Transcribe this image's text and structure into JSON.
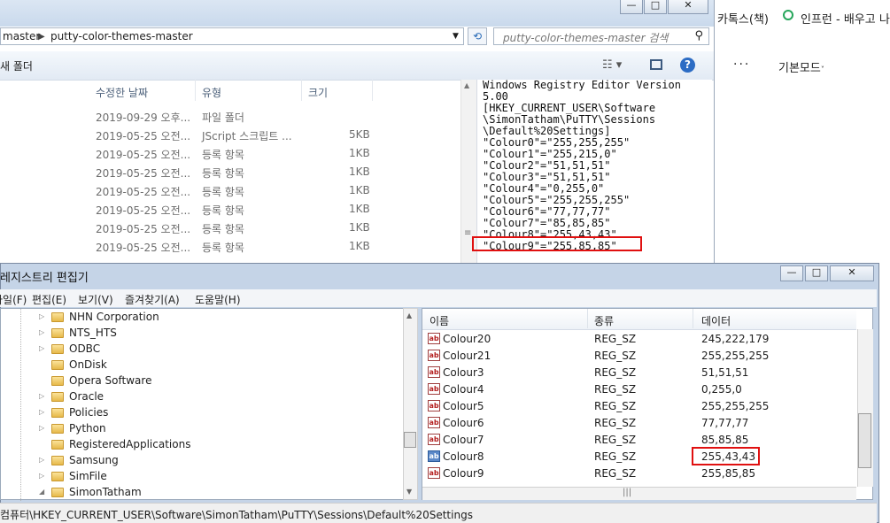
{
  "browser": {
    "bookmark_kakao": "카톡스(책)",
    "bookmark_inflearn": "인프런 - 배우고 나",
    "basic_mode": "기본모드",
    "more": "···"
  },
  "explorer": {
    "breadcrumb_prev": "master",
    "breadcrumb_current": "putty-color-themes-master",
    "search_placeholder": "putty-color-themes-master 검색",
    "new_folder": "새 폴더",
    "columns": {
      "modified": "수정한 날짜",
      "type": "유형",
      "size": "크기"
    },
    "files": [
      {
        "date": "2019-09-29 오후...",
        "type": "파일 폴더",
        "size": ""
      },
      {
        "date": "2019-05-25 오전...",
        "type": "JScript 스크립트 ...",
        "size": "5KB"
      },
      {
        "date": "2019-05-25 오전...",
        "type": "등록 항목",
        "size": "1KB"
      },
      {
        "date": "2019-05-25 오전...",
        "type": "등록 항목",
        "size": "1KB"
      },
      {
        "date": "2019-05-25 오전...",
        "type": "등록 항목",
        "size": "1KB"
      },
      {
        "date": "2019-05-25 오전...",
        "type": "등록 항목",
        "size": "1KB"
      },
      {
        "date": "2019-05-25 오전...",
        "type": "등록 항목",
        "size": "1KB"
      },
      {
        "date": "2019-05-25 오전...",
        "type": "등록 항목",
        "size": "1KB"
      }
    ],
    "preview_lines": [
      "Windows Registry Editor Version",
      "5.00",
      "",
      "[HKEY_CURRENT_USER\\Software",
      "\\SimonTatham\\PuTTY\\Sessions",
      "\\Default%20Settings]",
      "\"Colour0\"=\"255,255,255\"",
      "\"Colour1\"=\"255,215,0\"",
      "\"Colour2\"=\"51,51,51\"",
      "\"Colour3\"=\"51,51,51\"",
      "\"Colour4\"=\"0,255,0\"",
      "\"Colour5\"=\"255,255,255\"",
      "\"Colour6\"=\"77,77,77\"",
      "\"Colour7\"=\"85,85,85\"",
      "\"Colour8\"=\"255,43,43\"",
      "\"Colour9\"=\"255,85,85\""
    ]
  },
  "regedit": {
    "title": "레지스트리 편집기",
    "menu": [
      "파일(F)",
      "편집(E)",
      "보기(V)",
      "즐겨찾기(A)",
      "도움말(H)"
    ],
    "tree": [
      {
        "label": "NHN Corporation",
        "expandable": true
      },
      {
        "label": "NTS_HTS",
        "expandable": true
      },
      {
        "label": "ODBC",
        "expandable": true
      },
      {
        "label": "OnDisk",
        "expandable": false
      },
      {
        "label": "Opera Software",
        "expandable": false
      },
      {
        "label": "Oracle",
        "expandable": true
      },
      {
        "label": "Policies",
        "expandable": true
      },
      {
        "label": "Python",
        "expandable": true
      },
      {
        "label": "RegisteredApplications",
        "expandable": false
      },
      {
        "label": "Samsung",
        "expandable": true
      },
      {
        "label": "SimFile",
        "expandable": true
      },
      {
        "label": "SimonTatham",
        "expandable": true
      }
    ],
    "list_columns": {
      "name": "이름",
      "type": "종류",
      "data": "데이터"
    },
    "values": [
      {
        "name": "Colour20",
        "type": "REG_SZ",
        "data": "245,222,179"
      },
      {
        "name": "Colour21",
        "type": "REG_SZ",
        "data": "255,255,255"
      },
      {
        "name": "Colour3",
        "type": "REG_SZ",
        "data": "51,51,51"
      },
      {
        "name": "Colour4",
        "type": "REG_SZ",
        "data": "0,255,0"
      },
      {
        "name": "Colour5",
        "type": "REG_SZ",
        "data": "255,255,255"
      },
      {
        "name": "Colour6",
        "type": "REG_SZ",
        "data": "77,77,77"
      },
      {
        "name": "Colour7",
        "type": "REG_SZ",
        "data": "85,85,85"
      },
      {
        "name": "Colour8",
        "type": "REG_SZ",
        "data": "255,43,43"
      },
      {
        "name": "Colour9",
        "type": "REG_SZ",
        "data": "255,85,85"
      }
    ],
    "value_icon": "ab",
    "status_path": "컴퓨터\\HKEY_CURRENT_USER\\Software\\SimonTatham\\PuTTY\\Sessions\\Default%20Settings"
  },
  "colors": {
    "highlight": "#e01010",
    "accent": "#2b6cb8"
  }
}
